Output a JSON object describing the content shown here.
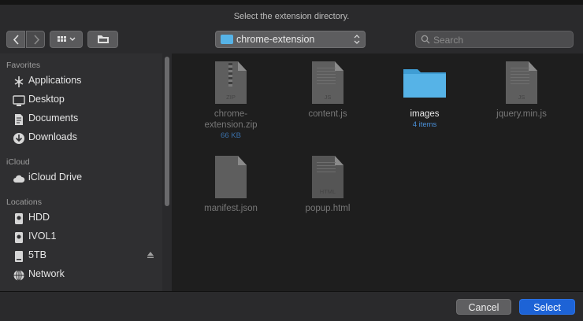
{
  "dialog": {
    "title": "Select the extension directory."
  },
  "toolbar": {
    "back_icon": "chevron-left-icon",
    "forward_icon": "chevron-right-icon",
    "view_icon": "grid-view-icon",
    "group_icon": "folder-action-icon",
    "path": "chrome-extension",
    "search_placeholder": "Search"
  },
  "sidebar": {
    "sections": [
      {
        "label": "Favorites",
        "items": [
          {
            "label": "Applications",
            "icon": "applications-icon"
          },
          {
            "label": "Desktop",
            "icon": "desktop-icon"
          },
          {
            "label": "Documents",
            "icon": "documents-icon"
          },
          {
            "label": "Downloads",
            "icon": "downloads-icon"
          }
        ]
      },
      {
        "label": "iCloud",
        "items": [
          {
            "label": "iCloud Drive",
            "icon": "cloud-icon"
          }
        ]
      },
      {
        "label": "Locations",
        "items": [
          {
            "label": "HDD",
            "icon": "disk-icon"
          },
          {
            "label": "IVOL1",
            "icon": "disk-icon"
          },
          {
            "label": "5TB",
            "icon": "drive-icon"
          },
          {
            "label": "Network",
            "icon": "network-icon"
          }
        ]
      }
    ]
  },
  "files": [
    {
      "name1": "chrome-",
      "name2": "extension.zip",
      "sub": "66 KB",
      "ext": "ZIP",
      "type": "zip"
    },
    {
      "name1": "content.js",
      "name2": "",
      "sub": "",
      "ext": "JS",
      "type": "doc"
    },
    {
      "name1": "images",
      "name2": "",
      "sub": "4 items",
      "ext": "",
      "type": "folder"
    },
    {
      "name1": "jquery.min.js",
      "name2": "",
      "sub": "",
      "ext": "JS",
      "type": "doc"
    },
    {
      "name1": "manifest.json",
      "name2": "",
      "sub": "",
      "ext": "",
      "type": "doc"
    },
    {
      "name1": "popup.html",
      "name2": "",
      "sub": "",
      "ext": "HTML",
      "type": "doc"
    }
  ],
  "footer": {
    "cancel": "Cancel",
    "select": "Select"
  },
  "colors": {
    "accent": "#1d63d6",
    "folder": "#56b3e7"
  }
}
